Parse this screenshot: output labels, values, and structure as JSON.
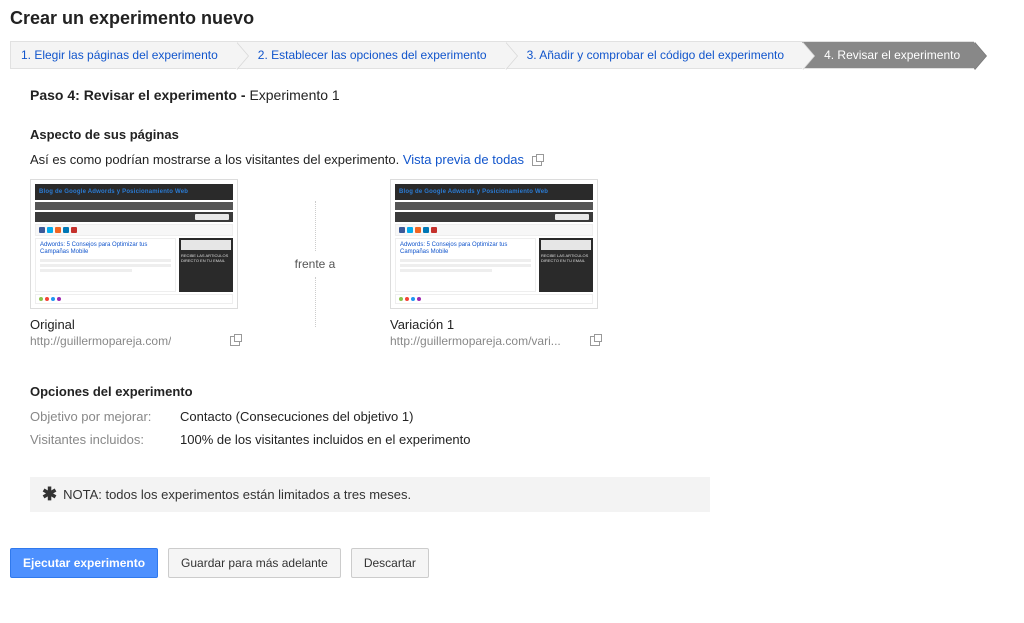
{
  "page_title": "Crear un experimento nuevo",
  "steps": [
    {
      "label": "1. Elegir las páginas del experimento",
      "active": false
    },
    {
      "label": "2. Establecer las opciones del experimento",
      "active": false
    },
    {
      "label": "3. Añadir y comprobar el código del experimento",
      "active": false
    },
    {
      "label": "4. Revisar el experimento",
      "active": true
    }
  ],
  "step_header": {
    "prefix": "Paso 4: Revisar el experimento - ",
    "name": "Experimento 1"
  },
  "appearance": {
    "title": "Aspecto de sus páginas",
    "intro": "Así es como podrían mostrarse a los visitantes del experimento.",
    "preview_link": "Vista previa de todas",
    "vs_label": "frente a",
    "thumb_headline": "Adwords: 5 Consejos para Optimizar tus Campañas Mobile",
    "original": {
      "label": "Original",
      "url": "http://guillermopareja.com/"
    },
    "variation": {
      "label": "Variación 1",
      "url": "http://guillermopareja.com/vari..."
    }
  },
  "options": {
    "title": "Opciones del experimento",
    "rows": [
      {
        "k": "Objetivo por mejorar:",
        "v": "Contacto (Consecuciones del objetivo 1)"
      },
      {
        "k": "Visitantes incluidos:",
        "v": "100% de los visitantes incluidos en el experimento"
      }
    ]
  },
  "note": "NOTA: todos los experimentos están limitados a tres meses.",
  "buttons": {
    "run": "Ejecutar experimento",
    "save": "Guardar para más adelante",
    "discard": "Descartar"
  }
}
